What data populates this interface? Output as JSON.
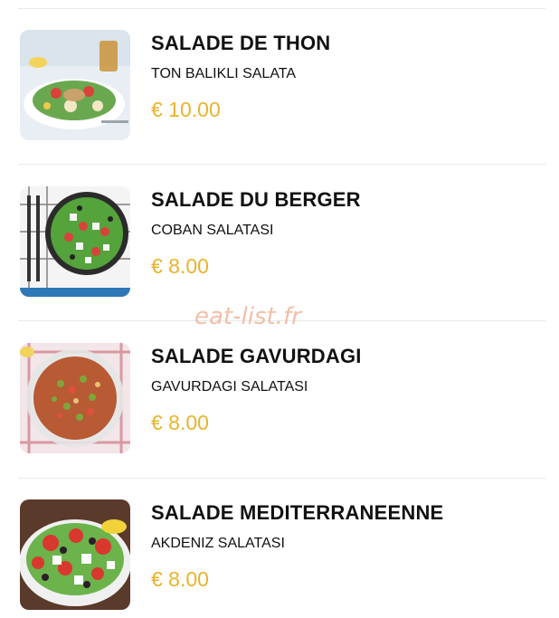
{
  "menu": {
    "items": [
      {
        "name": "SALADE DE THON",
        "subtitle": "TON BALIKLI SALATA",
        "price": "€ 10.00",
        "image": "tuna-salad-photo"
      },
      {
        "name": "SALADE DU BERGER",
        "subtitle": "COBAN SALATASI",
        "price": "€ 8.00",
        "image": "shepherd-salad-photo"
      },
      {
        "name": "SALADE GAVURDAGI",
        "subtitle": "GAVURDAGI SALATASI",
        "price": "€ 8.00",
        "image": "gavurdagi-salad-photo"
      },
      {
        "name": "SALADE MEDITERRANEENNE",
        "subtitle": "AKDENIZ SALATASI",
        "price": "€ 8.00",
        "image": "mediterranean-salad-photo"
      }
    ]
  },
  "watermark": "eat-list.fr",
  "colors": {
    "price": "#e9b32c",
    "text": "#111111",
    "divider": "#e9e9e9",
    "watermark": "#f0b49a"
  }
}
